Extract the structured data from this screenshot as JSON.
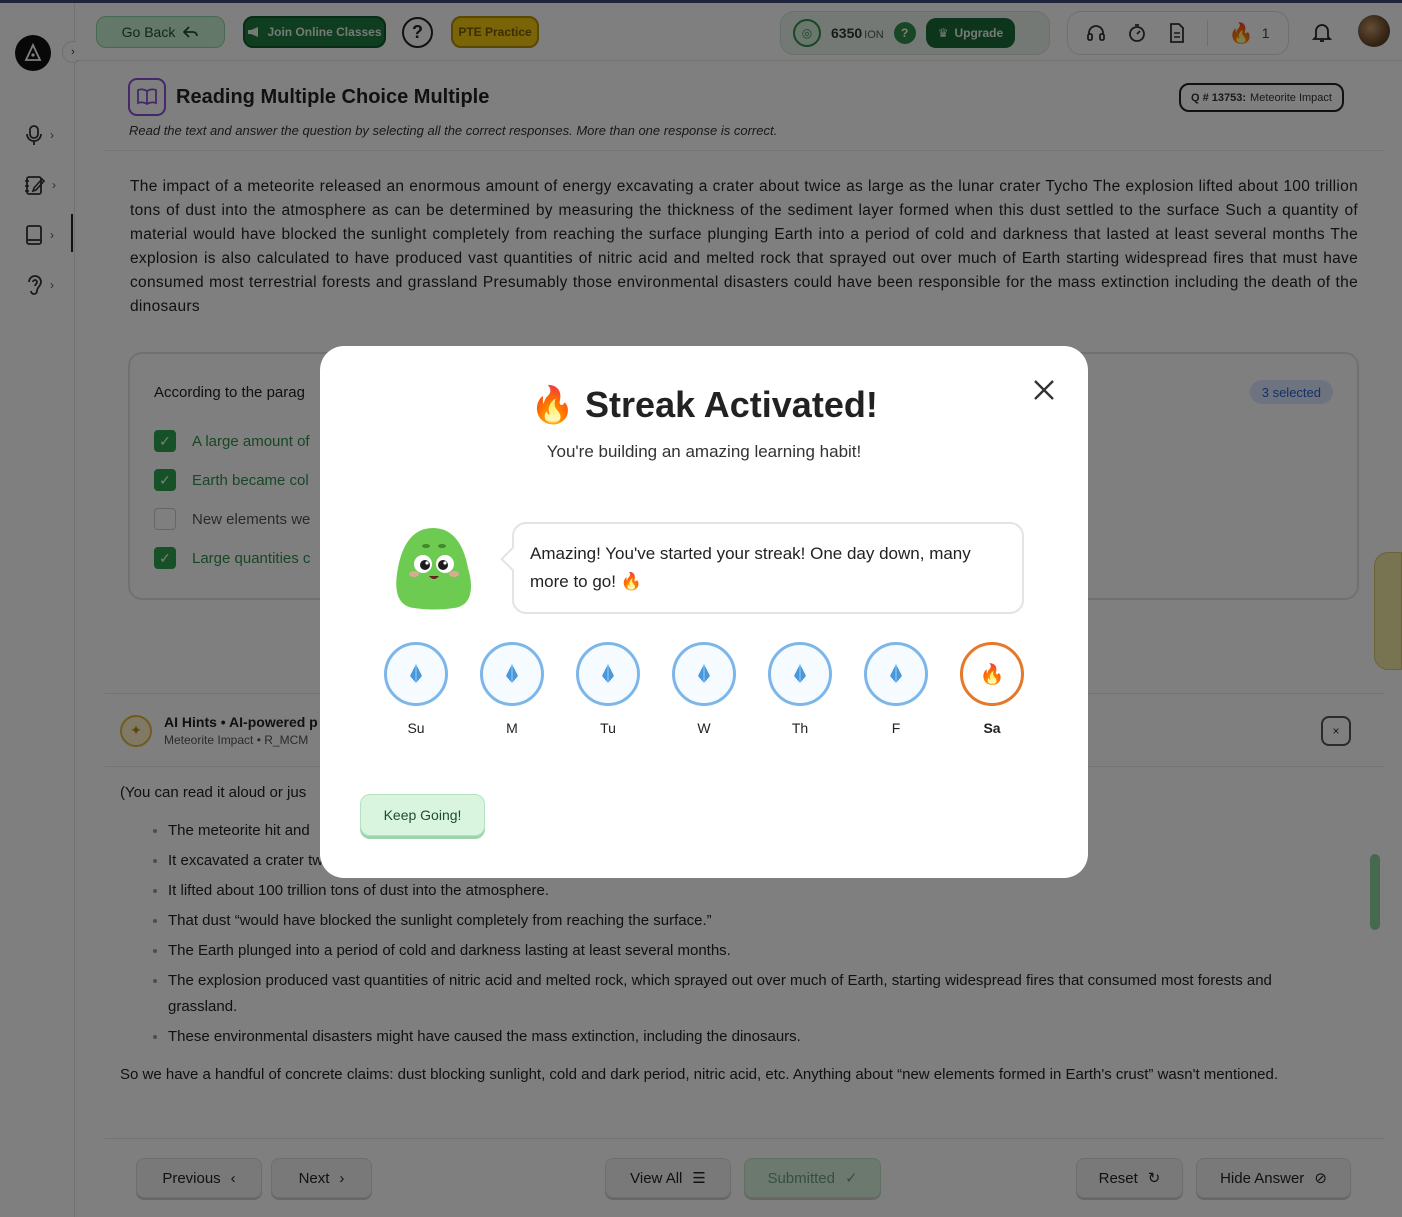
{
  "header": {
    "go_back": "Go Back",
    "join_classes": "Join Online Classes",
    "help": "?",
    "pte_practice": "PTE Practice",
    "ion_value": "6350",
    "ion_unit": "ION",
    "ion_help": "?",
    "upgrade": "Upgrade",
    "streak_count": "1"
  },
  "question": {
    "title": "Reading Multiple Choice Multiple",
    "instruction": "Read the text and answer the question by selecting all the correct responses. More than one response is correct.",
    "badge_id": "Q # 13753:",
    "badge_name": "Meteorite Impact",
    "passage": "The impact of a meteorite released an enormous amount of energy excavating a crater about twice as large as the lunar crater Tycho The explosion lifted about 100 trillion tons of dust into the atmosphere as can be determined by measuring the thickness of the sediment layer formed when this dust settled to the surface Such a quantity of material would have blocked the sunlight completely from reaching the surface plunging Earth into a period of cold and darkness that lasted at least several months The explosion is also calculated to have produced vast quantities of nitric acid and melted rock that sprayed out over much of Earth starting widespread fires that must have consumed most terrestrial forests and grassland Presumably those environmental disasters could have been responsible for the mass extinction including the death of the dinosaurs",
    "prompt": "According to the parag",
    "selected_badge": "3 selected",
    "options": [
      {
        "text": "A large amount of",
        "checked": true
      },
      {
        "text": "Earth became col",
        "checked": true
      },
      {
        "text": "New elements we",
        "checked": false
      },
      {
        "text": "Large quantities c",
        "checked": true
      }
    ]
  },
  "hints": {
    "title": "AI Hints • AI-powered p",
    "subtitle": "Meteorite Impact • R_MCM",
    "close": "×",
    "intro": "(You can read it aloud or jus",
    "items": [
      "The meteorite hit and",
      "It excavated a crater tw",
      "It lifted about 100 trillion tons of dust into the atmosphere.",
      "That dust “would have blocked the sunlight completely from reaching the surface.”",
      "The Earth plunged into a period of cold and darkness lasting at least several months.",
      "The explosion produced vast quantities of nitric acid and melted rock, which sprayed out over much of Earth, starting widespread fires that consumed most forests and grassland.",
      "These environmental disasters might have caused the mass extinction, including the dinosaurs."
    ],
    "conclusion": "So we have a handful of concrete claims: dust blocking sunlight, cold and dark period, nitric acid, etc. Anything about “new elements formed in Earth's crust” wasn't mentioned."
  },
  "footer": {
    "previous": "Previous",
    "next": "Next",
    "view_all": "View All",
    "submitted": "Submitted",
    "reset": "Reset",
    "hide_answer": "Hide Answer"
  },
  "modal": {
    "title": "Streak Activated!",
    "subtitle": "You're building an amazing learning habit!",
    "message": "Amazing! You've started your streak! One day down, many more to go! 🔥",
    "days": [
      {
        "label": "Su",
        "state": "frozen"
      },
      {
        "label": "M",
        "state": "frozen"
      },
      {
        "label": "Tu",
        "state": "frozen"
      },
      {
        "label": "W",
        "state": "frozen"
      },
      {
        "label": "Th",
        "state": "frozen"
      },
      {
        "label": "F",
        "state": "frozen"
      },
      {
        "label": "Sa",
        "state": "active"
      }
    ],
    "keep_going": "Keep Going!"
  },
  "colors": {
    "frozen": "#7db6e8",
    "active": "#e5782a",
    "accent_green": "#2fa34f"
  }
}
